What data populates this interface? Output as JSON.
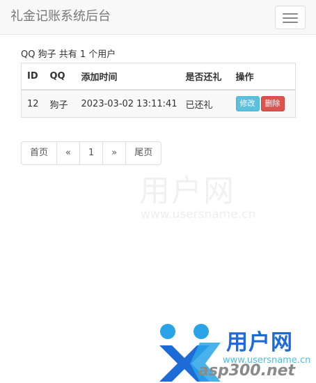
{
  "navbar": {
    "brand": "礼金记账系统后台",
    "menu_icon": "hamburger-menu-icon"
  },
  "summary": "QQ 狗子 共有 1 个用户",
  "table": {
    "headers": [
      "ID",
      "QQ",
      "添加时间",
      "是否还礼",
      "操作"
    ],
    "rows": [
      {
        "id": "12",
        "qq": "狗子",
        "added": "2023-03-02 13:11:41",
        "returned": "已还礼",
        "edit_label": "修改",
        "delete_label": "删除"
      }
    ]
  },
  "pagination": {
    "first": "首页",
    "prev": "«",
    "current": "1",
    "next": "»",
    "last": "尾页"
  },
  "watermark": {
    "center_text": "用户网",
    "center_url": "www.usersname.cn",
    "logo_text": "用户网",
    "logo_url": "www.usersname.cn",
    "logo_domain": "asp300.net"
  },
  "colors": {
    "edit_button": "#5bc0de",
    "delete_button": "#d9534f",
    "navbar_bg": "#f8f8f8",
    "logo_blue": "#1d6bd6",
    "logo_cyan": "#2aa4e6"
  }
}
